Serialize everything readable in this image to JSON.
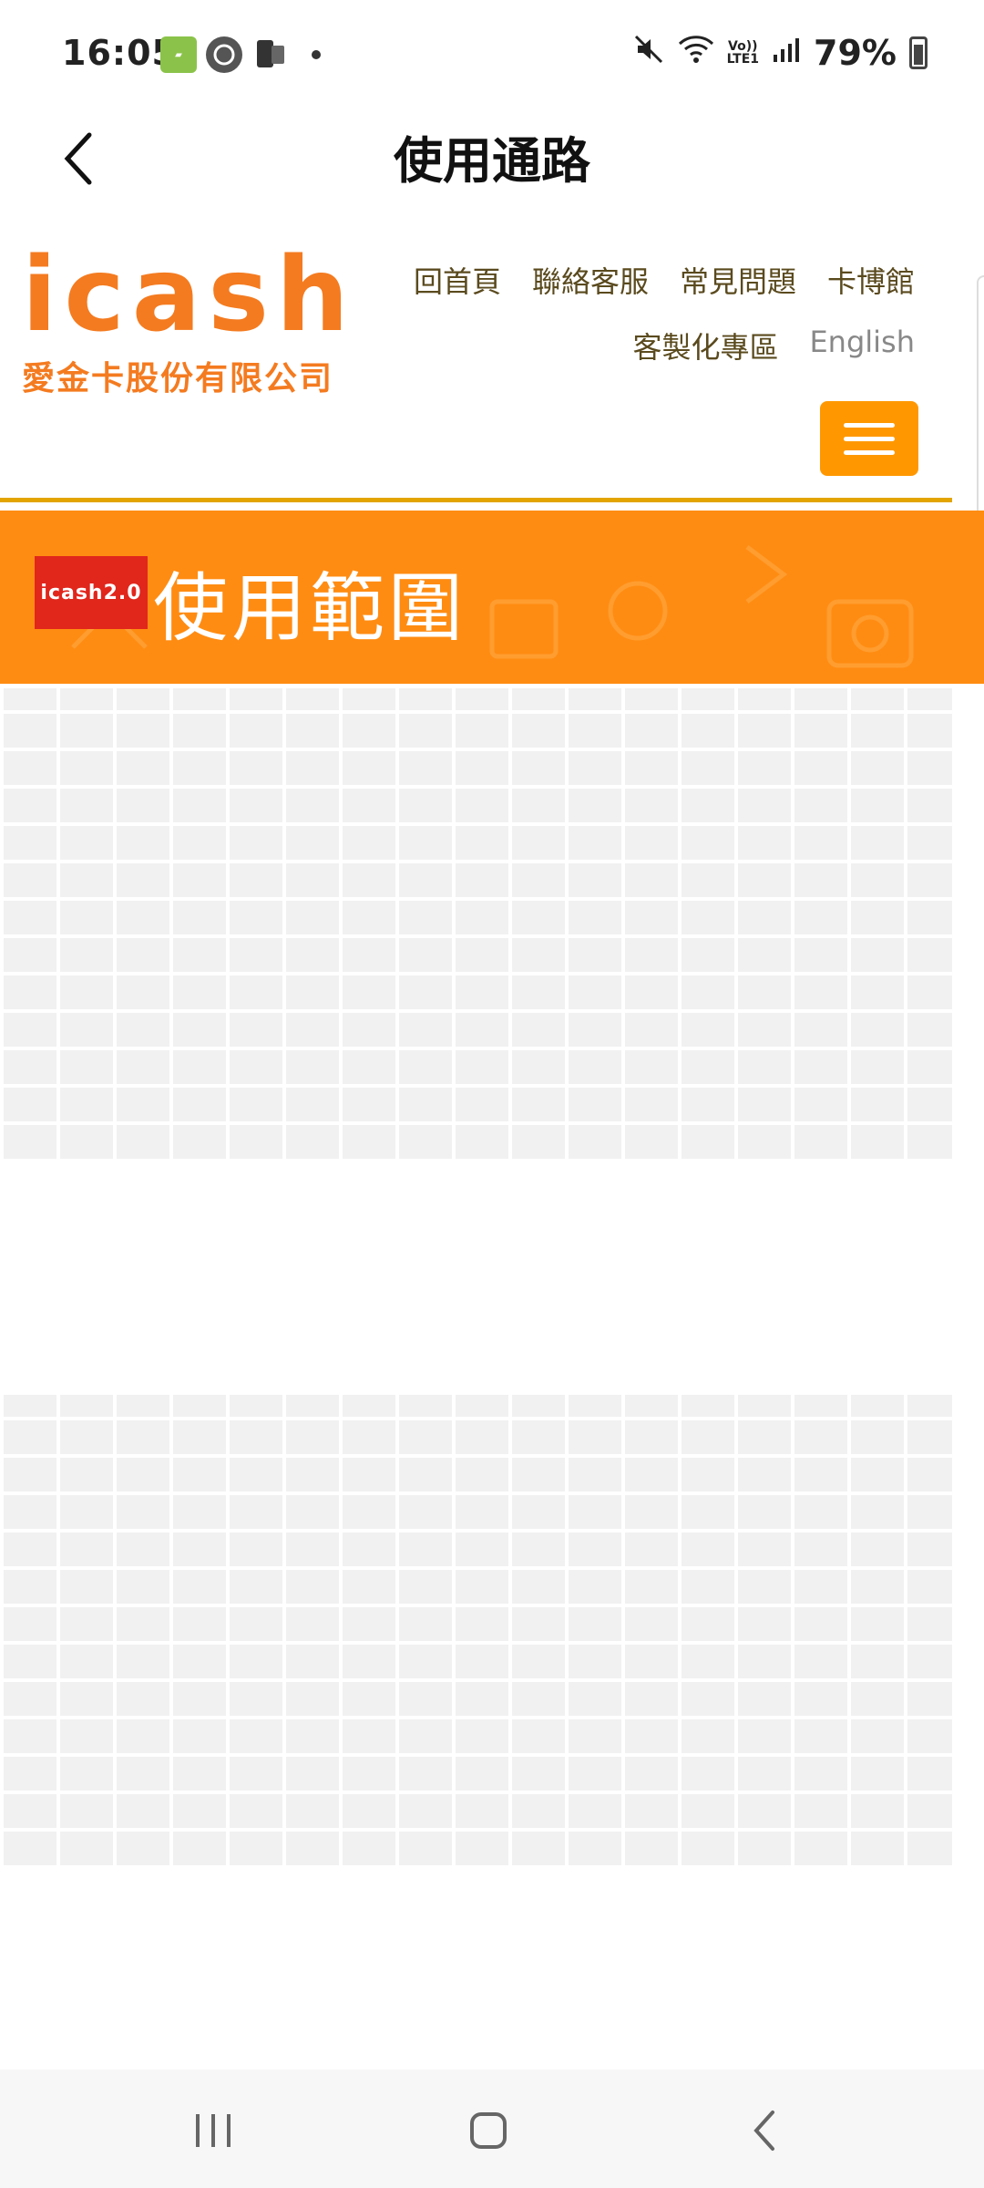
{
  "status_bar": {
    "time": "16:05",
    "left_icons": [
      "brooks-app-icon",
      "starbucks-app-icon",
      "phone-app-icon",
      "notification-dot"
    ],
    "right_icons": [
      "mute-icon",
      "wifi-icon",
      "volte-lte-icon",
      "signal-icon"
    ],
    "volte_label": "Vo))\nLTE1",
    "battery": "79%"
  },
  "app_header": {
    "title": "使用通路",
    "back_icon": "chevron-left-icon"
  },
  "site": {
    "logo_word": "icash",
    "logo_subtitle": "愛金卡股份有限公司",
    "nav_row1": [
      "回首頁",
      "聯絡客服",
      "常見問題",
      "卡博館"
    ],
    "nav_row2": [
      "客製化專區",
      "English"
    ],
    "menu_icon": "hamburger-icon",
    "accent_color": "#ff9800",
    "banner": {
      "logo_text": "icash2.0",
      "title": "使用範圍",
      "color": "#ff8c12"
    }
  },
  "nav_bar": {
    "items": [
      "recent-apps-icon",
      "home-icon",
      "back-icon"
    ]
  }
}
